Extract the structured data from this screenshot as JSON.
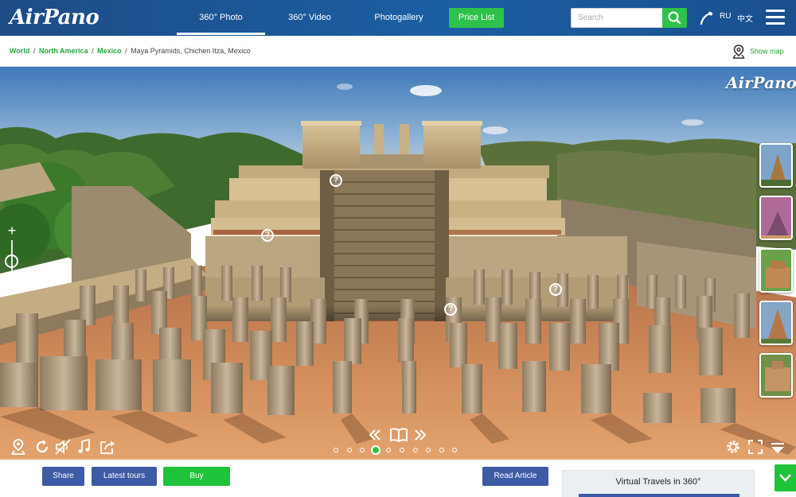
{
  "header": {
    "logo": "AirPano",
    "tabs": [
      {
        "label": "360° Photo",
        "active": true
      },
      {
        "label": "360° Video",
        "active": false
      },
      {
        "label": "Photogallery",
        "active": false
      }
    ],
    "price_list": "Price List",
    "search": {
      "placeholder": "Search",
      "value": ""
    },
    "phone_icon": "phone-icon",
    "languages": [
      "RU",
      "中文"
    ],
    "menu_icon": "hamburger-menu-icon"
  },
  "breadcrumb": {
    "links": [
      "World",
      "North America",
      "Mexico"
    ],
    "separator": "/",
    "current": "Maya Pyramids, Chichen Itza, Mexico"
  },
  "show_map": "Show map",
  "panorama": {
    "watermark": "AirPano",
    "hotspot_symbol": "?",
    "hotspot_count": 5,
    "zoom": {
      "plus": "+",
      "minus": "−"
    },
    "controls_left": [
      "map-pin-icon",
      "rotate-icon",
      "sound-off-icon",
      "music-icon",
      "share-icon"
    ],
    "controls_center": [
      "double-chevron-left-icon",
      "book-icon",
      "double-chevron-right-icon"
    ],
    "controls_right": [
      "settings-icon",
      "fullscreen-icon",
      "triangle-down-icon"
    ],
    "pages": {
      "total": 10,
      "current": 4
    },
    "thumbnail_count": 5
  },
  "bottom": {
    "share": "Share",
    "latest_tours": "Latest tours",
    "buy": "Buy",
    "read_article": "Read Article",
    "virtual_travels": "Virtual Travels in 360°"
  },
  "colors": {
    "nav_blue": "#1b5fa3",
    "accent_green": "#2fc24a",
    "button_blue": "#3d5aa5",
    "link_green": "#2aa23f"
  }
}
